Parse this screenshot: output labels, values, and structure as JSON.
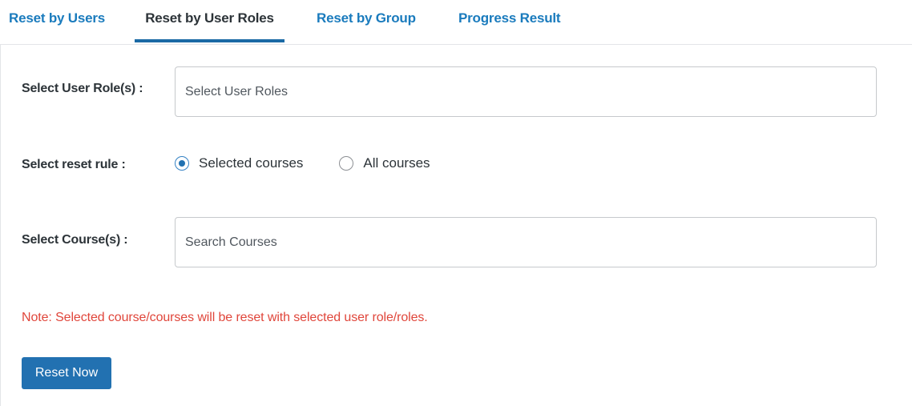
{
  "tabs": [
    {
      "label": "Reset by Users",
      "active": false
    },
    {
      "label": "Reset by User Roles",
      "active": true
    },
    {
      "label": "Reset by Group",
      "active": false
    },
    {
      "label": "Progress Result",
      "active": false
    }
  ],
  "form": {
    "user_roles": {
      "label": "Select User Role(s) :",
      "placeholder": "Select User Roles",
      "value": ""
    },
    "reset_rule": {
      "label": "Select reset rule :",
      "options": [
        {
          "label": "Selected courses",
          "checked": true
        },
        {
          "label": "All courses",
          "checked": false
        }
      ]
    },
    "courses": {
      "label": "Select Course(s) :",
      "placeholder": "Search Courses",
      "value": ""
    }
  },
  "note": "Note: Selected course/courses will be reset with selected user role/roles.",
  "reset_button": "Reset Now",
  "colors": {
    "link": "#1a7bbd",
    "accent": "#2271b1",
    "note": "#e0463b"
  }
}
